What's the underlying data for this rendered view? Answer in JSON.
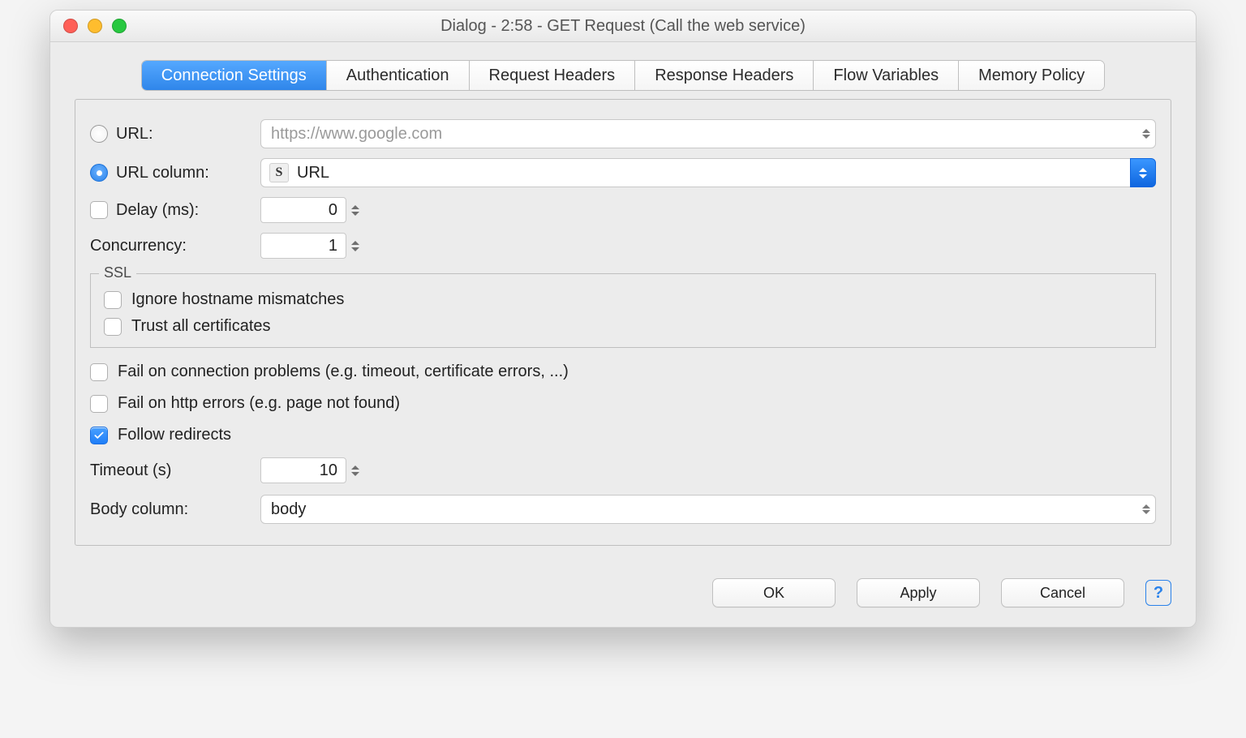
{
  "window": {
    "title": "Dialog - 2:58 - GET Request (Call the web service)"
  },
  "tabs": {
    "connection": "Connection Settings",
    "authentication": "Authentication",
    "request_headers": "Request Headers",
    "response_headers": "Response Headers",
    "flow_variables": "Flow Variables",
    "memory_policy": "Memory Policy",
    "active": "connection"
  },
  "form": {
    "url_label": "URL:",
    "url_placeholder": "https://www.google.com",
    "url_column_label": "URL column:",
    "url_column_value": "URL",
    "url_column_icon": "S",
    "url_mode_selected": "url_column",
    "delay_label": "Delay (ms):",
    "delay_value": "0",
    "delay_checked": false,
    "concurrency_label": "Concurrency:",
    "concurrency_value": "1",
    "ssl": {
      "legend": "SSL",
      "ignore_hostname_label": "Ignore hostname mismatches",
      "ignore_hostname_checked": false,
      "trust_all_label": "Trust all certificates",
      "trust_all_checked": false
    },
    "fail_conn_label": "Fail on connection problems (e.g. timeout, certificate errors, ...)",
    "fail_conn_checked": false,
    "fail_http_label": "Fail on http errors (e.g. page not found)",
    "fail_http_checked": false,
    "follow_redirects_label": "Follow redirects",
    "follow_redirects_checked": true,
    "timeout_label": "Timeout (s)",
    "timeout_value": "10",
    "body_column_label": "Body column:",
    "body_column_value": "body"
  },
  "footer": {
    "ok": "OK",
    "apply": "Apply",
    "cancel": "Cancel",
    "help_symbol": "?"
  }
}
